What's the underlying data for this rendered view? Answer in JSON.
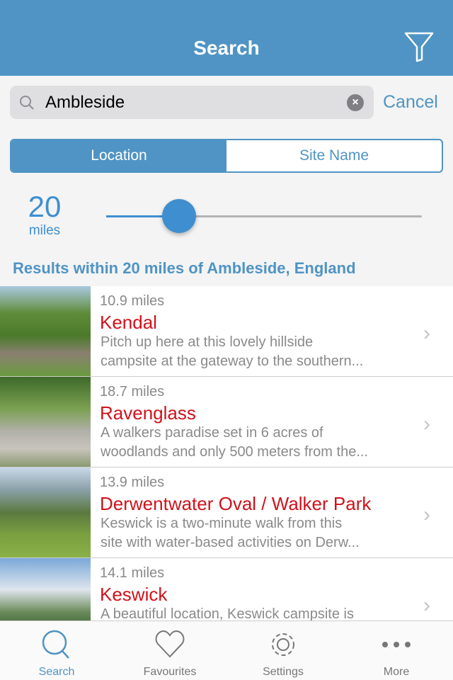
{
  "header": {
    "title": "Search",
    "filter_icon": "filter-icon"
  },
  "search": {
    "value": "Ambleside",
    "cancel_label": "Cancel"
  },
  "segments": [
    {
      "label": "Location",
      "selected": true
    },
    {
      "label": "Site Name",
      "selected": false
    }
  ],
  "distance": {
    "value": "20",
    "unit": "miles",
    "slider_fraction": 0.23
  },
  "results_heading": "Results within 20 miles of Ambleside, England",
  "results": [
    {
      "distance": "10.9 miles",
      "name": "Kendal",
      "desc1": "Pitch up here at this lovely hillside",
      "desc2": "campsite at the gateway to the southern..."
    },
    {
      "distance": "18.7 miles",
      "name": "Ravenglass",
      "desc1": "A walkers paradise set in 6 acres of",
      "desc2": "woodlands and only 500 meters from the..."
    },
    {
      "distance": "13.9 miles",
      "name": "Derwentwater Oval / Walker Park",
      "desc1": "Keswick is a two-minute walk from this",
      "desc2": "site with water-based activities on Derw..."
    },
    {
      "distance": "14.1 miles",
      "name": "Keswick",
      "desc1": "A beautiful location, Keswick campsite is",
      "desc2": ""
    }
  ],
  "tabs": [
    {
      "label": "Search",
      "active": true
    },
    {
      "label": "Favourites"
    },
    {
      "label": "Settings"
    },
    {
      "label": "More"
    }
  ],
  "colors": {
    "brand": "#4f94c4",
    "accent": "#3f8fd0",
    "site_name": "#d0121b"
  }
}
